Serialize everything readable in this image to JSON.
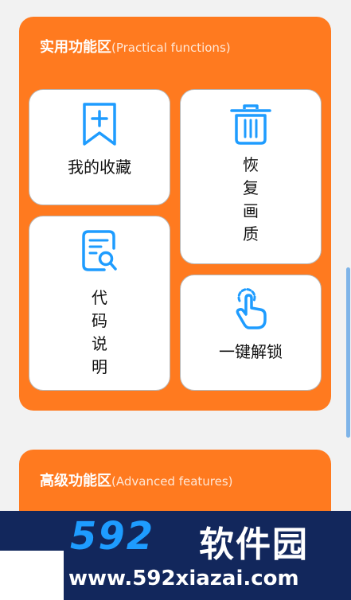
{
  "practical": {
    "title": "实用功能区",
    "subtitle": "(Practical functions)",
    "cards": [
      {
        "label": "我的收藏",
        "icon": "bookmark-add-icon"
      },
      {
        "label": "恢复画质",
        "icon": "trash-icon"
      },
      {
        "label": "代码说明",
        "icon": "document-search-icon"
      },
      {
        "label": "一键解锁",
        "icon": "tap-finger-icon"
      }
    ]
  },
  "advanced": {
    "title": "高级功能区",
    "subtitle": "(Advanced features)"
  },
  "watermark": {
    "brand_number": "592",
    "brand_cn": "软件园",
    "url": "www.592xiazai.com"
  },
  "colors": {
    "panel": "#ff7a1f",
    "icon": "#1e9cff",
    "card": "#ffffff"
  }
}
